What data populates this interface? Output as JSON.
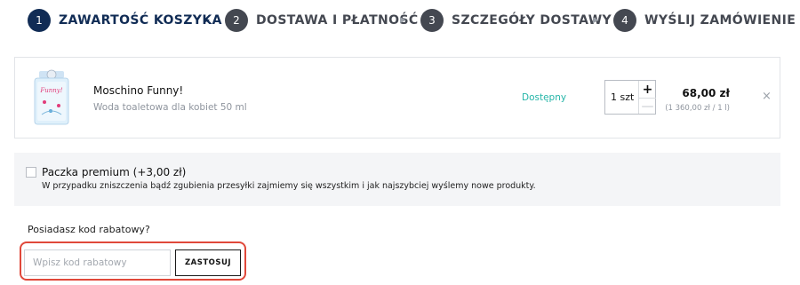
{
  "steps": [
    {
      "number": "1",
      "label": "ZAWARTOŚĆ KOSZYKA",
      "active": true
    },
    {
      "number": "2",
      "label": "DOSTAWA I PŁATNOŚĆ",
      "active": false
    },
    {
      "number": "3",
      "label": "SZCZEGÓŁY DOSTAWY",
      "active": false
    },
    {
      "number": "4",
      "label": "WYŚLIJ ZAMÓWIENIE",
      "active": false
    }
  ],
  "cart_item": {
    "name": "Moschino Funny!",
    "description": "Woda toaletowa dla kobiet 50 ml",
    "availability": "Dostępny",
    "quantity": "1 szt",
    "plus_symbol": "+",
    "minus_symbol": "—",
    "price": "68,00 zł",
    "unit_price": "(1 360,00  zł / 1 l)",
    "remove_symbol": "×",
    "bottle_label": "Funny!"
  },
  "premium": {
    "title": "Paczka premium (+3,00 zł)",
    "description": "W przypadku zniszczenia bądź zgubienia przesyłki zajmiemy się wszystkim i jak najszybciej wyślemy nowe produkty."
  },
  "discount": {
    "label": "Posiadasz kod rabatowy?",
    "placeholder": "Wpisz kod rabatowy",
    "button_label": "ZASTOSUJ"
  },
  "colors": {
    "active_step": "#112c55",
    "inactive_step": "#444851",
    "availability": "#25b5a8",
    "highlight_frame": "#e0483a"
  }
}
